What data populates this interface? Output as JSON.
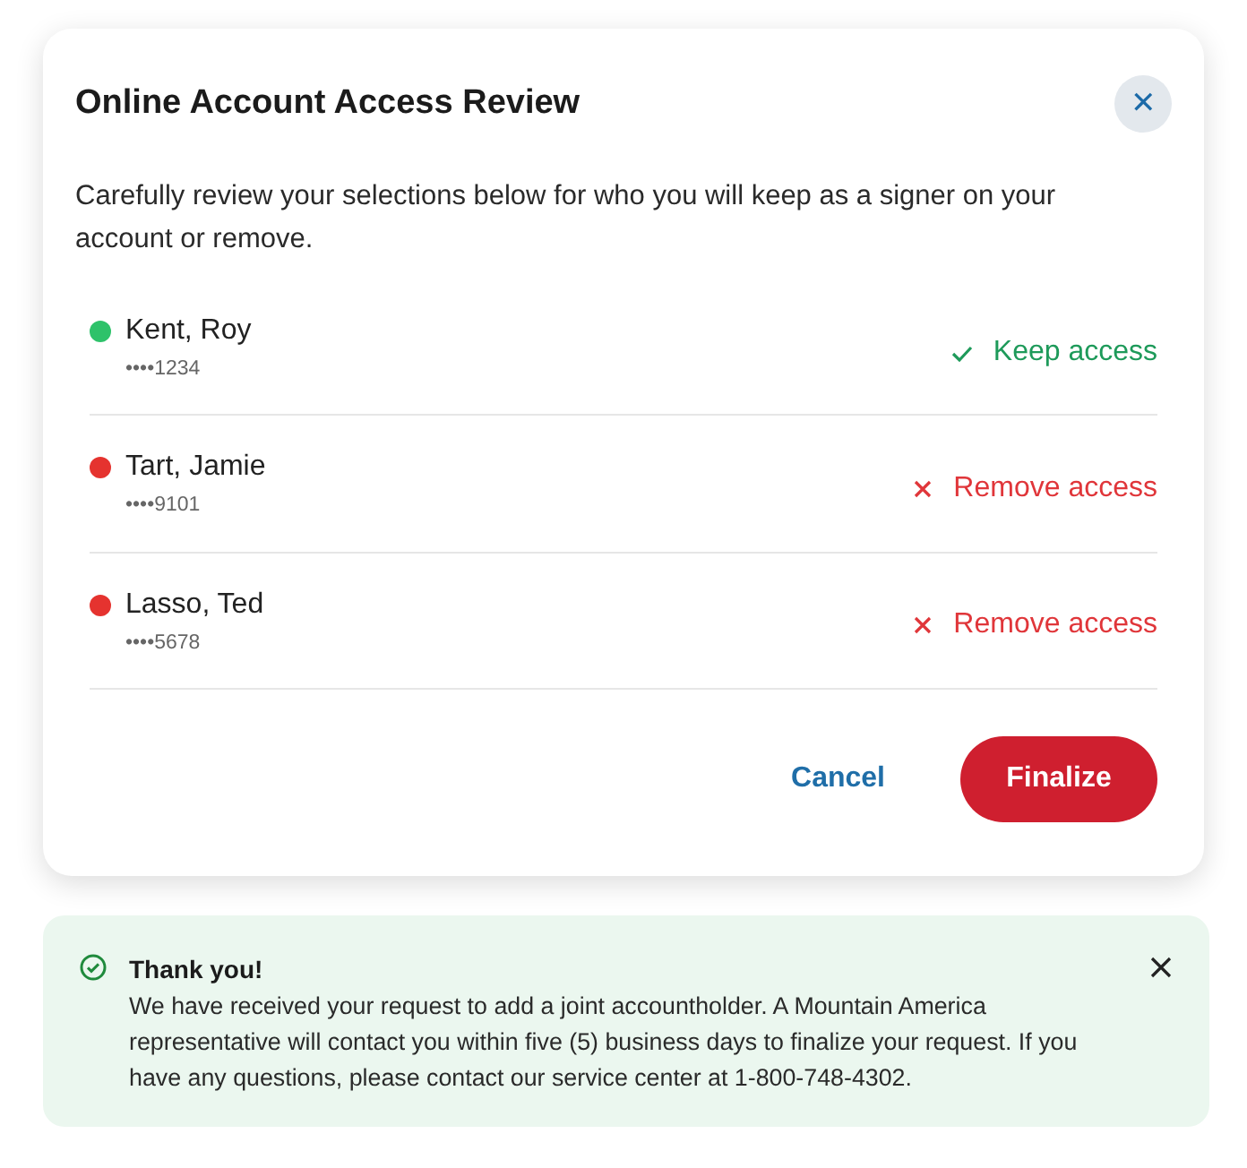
{
  "dialog": {
    "title": "Online Account Access Review",
    "close_label": "✕",
    "description": "Carefully review your selections below for who you will keep as a signer on your account or remove.",
    "signers": [
      {
        "name": "Kent, Roy",
        "account": "••••1234",
        "color": "#2ec26a",
        "kind": "keep",
        "action": "Keep access"
      },
      {
        "name": "Tart, Jamie",
        "account": "••••9101",
        "color": "#e5332f",
        "kind": "remove",
        "action": "Remove access"
      },
      {
        "name": "Lasso, Ted",
        "account": "••••5678",
        "color": "#e5332f",
        "kind": "remove",
        "action": "Remove access"
      }
    ],
    "buttons": {
      "cancel": "Cancel",
      "finalize": "Finalize"
    }
  },
  "toast": {
    "title": "Thank you!",
    "message": "We have received your request to add a joint accountholder. A Mountain America representative will contact you within five (5) business days to finalize your request. If you have any questions, please contact our service center at 1-800-748-4302."
  }
}
